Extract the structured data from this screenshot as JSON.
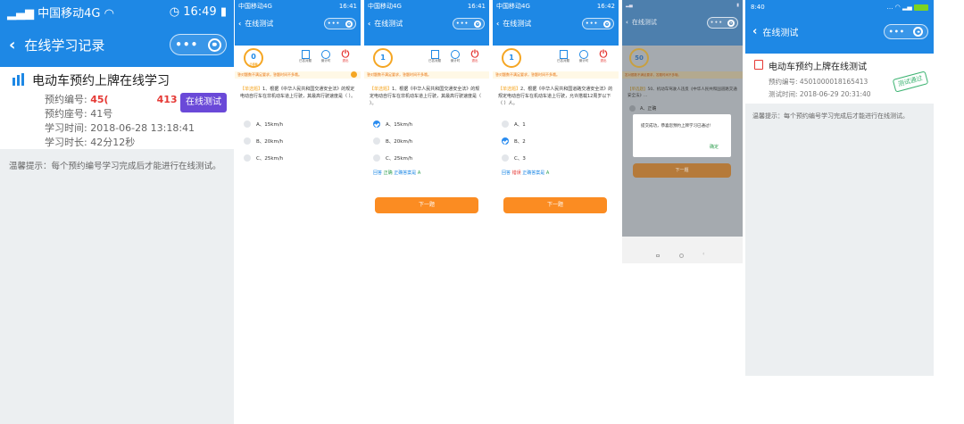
{
  "p1": {
    "status": {
      "carrier": "中国移动4G",
      "time": "16:49"
    },
    "nav_title": "在线学习记录",
    "course_title": "电动车预约上牌在线学习",
    "rows": [
      {
        "label": "预约编号:",
        "value": "45(",
        "value2": "413"
      },
      {
        "label": "预约座号:",
        "value": "41号"
      },
      {
        "label": "学习时间:",
        "value": "2018-06-28 13:18:41"
      },
      {
        "label": "学习时长:",
        "value": "42分12秒"
      }
    ],
    "test_button": "在线测试",
    "tip": "温馨提示：每个预约编号学习完成后才能进行在线测试。"
  },
  "p2": {
    "status": {
      "carrier": "中国移动4G",
      "time": "16:41"
    },
    "nav_title": "在线测试",
    "score": "0",
    "score_sub": "已答题",
    "tools": [
      "已答对题",
      "倒计时",
      "退出"
    ],
    "notice": "答对题数不满足要求，答题时间不多哦。",
    "question_tag": "【单选题】",
    "question": "1、根据《中华人民共和国交通安全法》的规定电动自行车在非机动车道上行驶，其最高行驶速度是（ ）。",
    "options": [
      "A、15km/h",
      "B、20km/h",
      "C、25km/h"
    ]
  },
  "p3": {
    "status": {
      "carrier": "中国移动4G",
      "time": "16:41"
    },
    "nav_title": "在线测试",
    "score": "1",
    "tools": [
      "已答对题",
      "倒计时",
      "退出"
    ],
    "notice": "答对题数不满足要求，答题时间不多哦。",
    "question_tag": "【单选题】",
    "question": "1、根据《中华人民共和国交通安全法》的规定电动自行车在非机动车道上行驶，其最高行驶速度是（ ）。",
    "options": [
      "A、15km/h",
      "B、20km/h",
      "C、25km/h"
    ],
    "answer": {
      "a": "回答",
      "b": "正确",
      "c": "正确答案是",
      "d": "A"
    },
    "next": "下一题"
  },
  "p4": {
    "status": {
      "carrier": "中国移动4G",
      "time": "16:42"
    },
    "nav_title": "在线测试",
    "score": "1",
    "tools": [
      "已答对题",
      "倒计时",
      "退出"
    ],
    "notice": "答对题数不满足要求，答题时间不多哦。",
    "question_tag": "【单选题】",
    "question": "2、根据《中华人民共和国道路交通安全法》的规定电动自行车在机动车道上行驶，允许搭载12周岁以下（ ）人。",
    "options": [
      "A、1",
      "B、2",
      "C、3"
    ],
    "answer": {
      "a": "回答",
      "b": "错误",
      "c": "正确答案是",
      "d": "A"
    },
    "next": "下一题"
  },
  "p5": {
    "nav_title": "在线测试",
    "score": "50",
    "notice": "答对题数不满足要求，答题时间不多哦。",
    "question_tag": "【单选题】",
    "question": "50、机动车驾驶人违反《中华人民共和国道路交通安全法》...",
    "option_a": "A、正确",
    "dialog_text": "提交成功，恭喜您预约上牌学习已通过!",
    "dialog_ok": "确定",
    "next": "下一题"
  },
  "p6": {
    "status": {
      "time": "8:40"
    },
    "nav_title": "在线测试",
    "course_title": "电动车预约上牌在线测试",
    "rows": [
      {
        "label": "预约编号:",
        "value": "4501000018165413"
      },
      {
        "label": "测试时间:",
        "value": "2018-06-29 20:31:40"
      }
    ],
    "stamp": "测试通过",
    "tip": "温馨提示：每个预约编号学习完成后才能进行在线测试。"
  },
  "colors": {
    "nav_blue": "#1e88e5",
    "purple_btn": "#6a49d8",
    "orange": "#fb8c22",
    "bg_gray": "#eceff1"
  }
}
